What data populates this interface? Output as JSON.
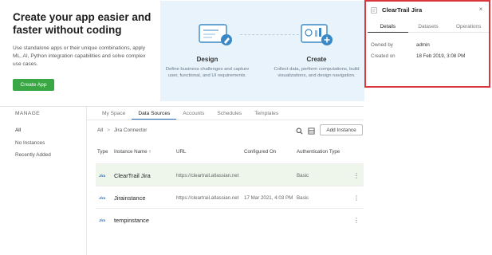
{
  "hero": {
    "title_line1": "Create your app easier and",
    "title_line2": "faster without coding",
    "description": "Use standalone apps or their unique combinations, apply ML, AI, Python integration capabilities and solve complex use cases.",
    "create_app_label": "Create App"
  },
  "steps": [
    {
      "title": "Design",
      "description": "Define business challenges and capture user, functional, and UI requirements.",
      "icon": "design-board-icon"
    },
    {
      "title": "Create",
      "description": "Collect data, perform computations, build visualizations, and design navigation.",
      "icon": "create-board-icon"
    }
  ],
  "sidebar": {
    "header": "MANAGE",
    "items": [
      "All",
      "No Instances",
      "Recently Added"
    ]
  },
  "tabs": [
    "My Space",
    "Data Sources",
    "Accounts",
    "Schedules",
    "Templates"
  ],
  "breadcrumb": {
    "root": "All",
    "separator": ">",
    "current": "Jira Connector"
  },
  "toolbar": {
    "add_instance_label": "Add Instance",
    "icons": [
      "search-icon",
      "grid-icon"
    ]
  },
  "table": {
    "columns": [
      "Type",
      "Instance Name ↑",
      "URL",
      "Configured On",
      "Authentication Type"
    ],
    "type_logo": "Jira",
    "rows": [
      {
        "name": "ClearTrail Jira",
        "url": "https://cleartrail.atlassian.net",
        "configured_on": "",
        "auth": "Basic",
        "selected": true
      },
      {
        "name": "Jirainstance",
        "url": "https://cleartrail.atlassian.net",
        "configured_on": "17 Mar 2021, 4:03 PM",
        "auth": "Basic",
        "selected": false
      },
      {
        "name": "tempinstance",
        "url": "",
        "configured_on": "",
        "auth": "",
        "selected": false
      }
    ]
  },
  "detail_panel": {
    "title": "ClearTrail Jira",
    "close_glyph": "×",
    "tabs": [
      "Details",
      "Datasets",
      "Operations"
    ],
    "fields": [
      {
        "label": "Owned by",
        "value": "admin"
      },
      {
        "label": "Created on",
        "value": "18 Feb 2019, 3:08 PM"
      }
    ],
    "highlight_color": "#d9363e"
  },
  "colors": {
    "accent_green": "#3aa745",
    "tab_underline": "#2a6ebb",
    "hero_bg": "#e8f3fb",
    "selected_row": "#eef6ec"
  }
}
